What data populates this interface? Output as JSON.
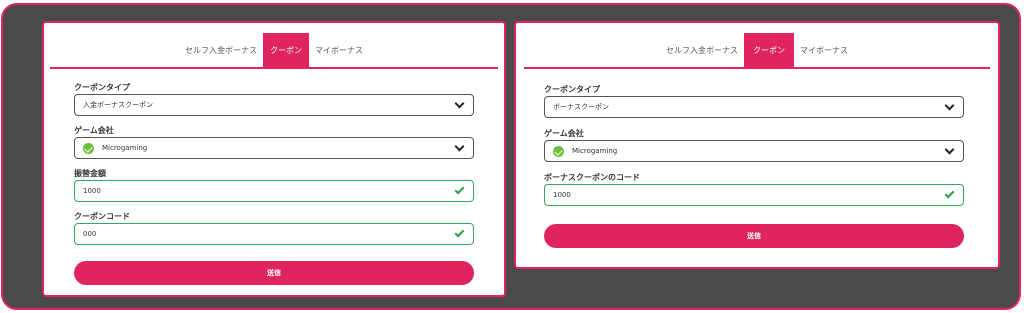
{
  "colors": {
    "accent": "#e0245e",
    "frame_bg": "#4a4a4a",
    "valid": "#2e9e4e"
  },
  "left_card": {
    "tabs": [
      {
        "label": "セルフ入金ボーナス",
        "active": false
      },
      {
        "label": "クーポン",
        "active": true
      },
      {
        "label": "マイボーナス",
        "active": false
      }
    ],
    "coupon_type": {
      "label": "クーポンタイプ",
      "value": "入金ボーナスクーポン"
    },
    "game_company": {
      "label": "ゲーム会社",
      "value": "Microgaming"
    },
    "transfer_amount": {
      "label": "振替金額",
      "value": "1000"
    },
    "coupon_code": {
      "label": "クーポンコード",
      "value": "000"
    },
    "submit_label": "送信"
  },
  "right_card": {
    "tabs": [
      {
        "label": "セルフ入金ボーナス",
        "active": false
      },
      {
        "label": "クーポン",
        "active": true
      },
      {
        "label": "マイボーナス",
        "active": false
      }
    ],
    "coupon_type": {
      "label": "クーポンタイプ",
      "value": "ボーナスクーポン"
    },
    "game_company": {
      "label": "ゲーム会社",
      "value": "Microgaming"
    },
    "bonus_coupon_code": {
      "label": "ボーナスクーポンのコード",
      "value": "1000"
    },
    "submit_label": "送信"
  }
}
